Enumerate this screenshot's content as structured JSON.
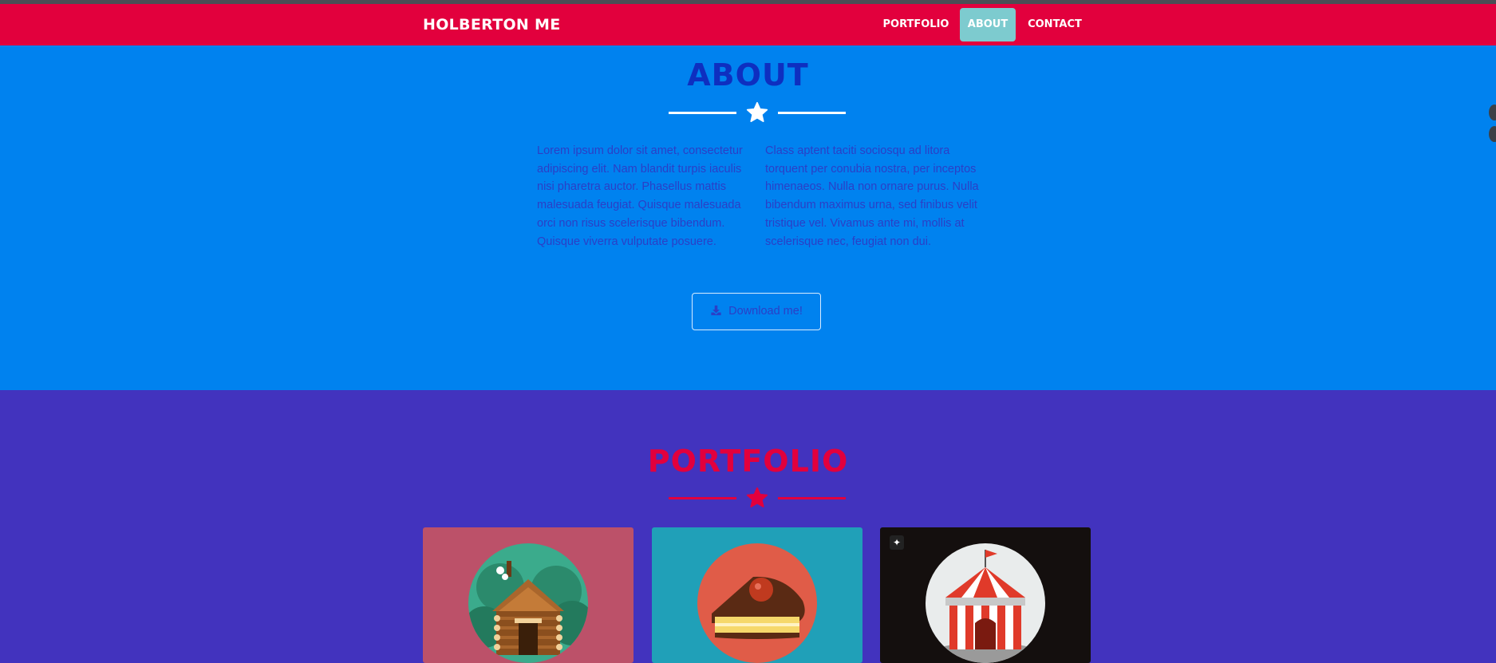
{
  "navbar": {
    "brand": "HOLBERTON ME",
    "links": [
      {
        "label": "PORTFOLIO",
        "active": false
      },
      {
        "label": "ABOUT",
        "active": true
      },
      {
        "label": "CONTACT",
        "active": false
      }
    ]
  },
  "about": {
    "title": "ABOUT",
    "column1": "Lorem ipsum dolor sit amet, consectetur adipiscing elit. Nam blandit turpis iaculis nisi pharetra auctor. Phasellus mattis malesuada feugiat. Quisque malesuada orci non risus scelerisque bibendum. Quisque viverra vulputate posuere.",
    "column2": "Class aptent taciti sociosqu ad litora torquent per conubia nostra, per inceptos himenaeos. Nulla non ornare purus. Nulla bibendum maximus urna, sed finibus velit tristique vel. Vivamus ante mi, mollis at scelerisque nec, feugiat non dui.",
    "download_label": "Download me!"
  },
  "portfolio": {
    "title": "PORTFOLIO",
    "items": [
      {
        "icon": "log-cabin-icon"
      },
      {
        "icon": "cake-slice-icon"
      },
      {
        "icon": "circus-tent-icon"
      }
    ]
  },
  "colors": {
    "nav_bg": "#e2003d",
    "about_bg": "#0082ef",
    "portfolio_bg": "#4233be",
    "accent_active": "#7dcbcf"
  }
}
